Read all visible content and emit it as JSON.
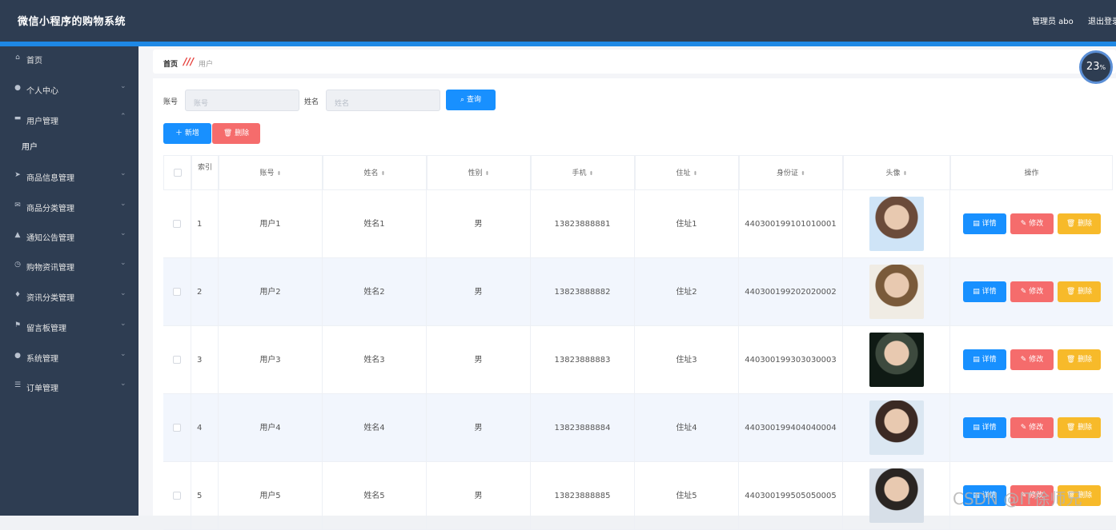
{
  "app": {
    "title": "微信小程序的购物系统",
    "user": "管理员 abo",
    "logout": "退出登录"
  },
  "sidebar": {
    "items": [
      {
        "label": "首页",
        "icon": "home-icon",
        "glyph": "⌂",
        "arrow": ""
      },
      {
        "label": "个人中心",
        "icon": "user-icon",
        "glyph": "●",
        "arrow": "⌄"
      },
      {
        "label": "用户管理",
        "icon": "monitor-icon",
        "glyph": "▬",
        "arrow": "⌃"
      },
      {
        "label": "商品信息管理",
        "icon": "send-icon",
        "glyph": "➤",
        "arrow": "⌄"
      },
      {
        "label": "商品分类管理",
        "icon": "mail-icon",
        "glyph": "✉",
        "arrow": "⌄"
      },
      {
        "label": "通知公告管理",
        "icon": "thumb-icon",
        "glyph": "▲",
        "arrow": "⌄"
      },
      {
        "label": "购物资讯管理",
        "icon": "clock-icon",
        "glyph": "◷",
        "arrow": "⌄"
      },
      {
        "label": "资讯分类管理",
        "icon": "bulb-icon",
        "glyph": "♦",
        "arrow": "⌄"
      },
      {
        "label": "留言板管理",
        "icon": "flag-icon",
        "glyph": "⚑",
        "arrow": "⌄"
      },
      {
        "label": "系统管理",
        "icon": "user-icon",
        "glyph": "●",
        "arrow": "⌄"
      },
      {
        "label": "订单管理",
        "icon": "menu-icon",
        "glyph": "☰",
        "arrow": "⌄"
      }
    ],
    "sub_item": "用户"
  },
  "breadcrumb": {
    "home": "首页",
    "sep": "///",
    "current": "用户"
  },
  "search": {
    "account_label": "账号",
    "account_placeholder": "账号",
    "name_label": "姓名",
    "name_placeholder": "姓名",
    "query_button": "查询"
  },
  "actions": {
    "add": "新增",
    "delete": "删除"
  },
  "table": {
    "headers": [
      "索引",
      "账号",
      "姓名",
      "性别",
      "手机",
      "住址",
      "身份证",
      "头像",
      "操作"
    ],
    "rows": [
      {
        "index": "1",
        "account": "用户1",
        "name": "姓名1",
        "gender": "男",
        "phone": "13823888881",
        "address": "住址1",
        "idcard": "440300199101010001"
      },
      {
        "index": "2",
        "account": "用户2",
        "name": "姓名2",
        "gender": "男",
        "phone": "13823888882",
        "address": "住址2",
        "idcard": "440300199202020002"
      },
      {
        "index": "3",
        "account": "用户3",
        "name": "姓名3",
        "gender": "男",
        "phone": "13823888883",
        "address": "住址3",
        "idcard": "440300199303030003"
      },
      {
        "index": "4",
        "account": "用户4",
        "name": "姓名4",
        "gender": "男",
        "phone": "13823888884",
        "address": "住址4",
        "idcard": "440300199404040004"
      },
      {
        "index": "5",
        "account": "用户5",
        "name": "姓名5",
        "gender": "男",
        "phone": "13823888885",
        "address": "住址5",
        "idcard": "440300199505050005"
      }
    ],
    "row_buttons": {
      "detail": "详情",
      "edit": "修改",
      "delete": "删除"
    }
  },
  "gauge": {
    "value": "23",
    "unit": "%"
  },
  "watermark": "CSDN @IT徐师兄",
  "colors": {
    "header": "#2e3d52",
    "accent": "#1890ff",
    "danger": "#f56c6c",
    "warning": "#f7ba2a"
  }
}
